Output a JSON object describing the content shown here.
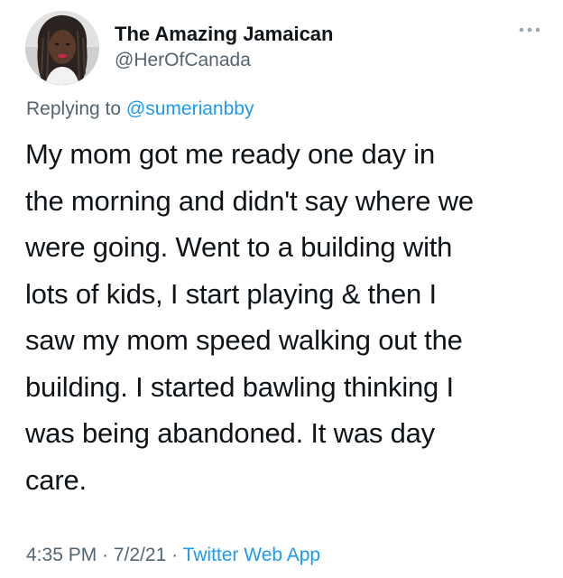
{
  "tweet": {
    "author": {
      "display_name": "The Amazing Jamaican",
      "handle": "@HerOfCanada",
      "avatar_icon": "profile-photo"
    },
    "more_icon": "ellipsis-icon",
    "replying": {
      "prefix": "Replying to ",
      "mention": "@sumerianbby"
    },
    "text_lines": [
      "My mom got me ready one day in",
      "the morning and didn't say where we",
      "were going. Went to a building with",
      "lots of kids, I start playing & then I",
      "saw my mom speed walking out the",
      "building. I started bawling thinking I",
      "was being abandoned. It was day",
      "care."
    ],
    "meta": {
      "time": "4:35 PM",
      "separator": " · ",
      "date": "7/2/21",
      "source": "Twitter Web App"
    }
  },
  "colors": {
    "text_primary": "#0f1419",
    "text_secondary": "#536471",
    "accent": "#1d9bf0",
    "background": "#ffffff"
  }
}
